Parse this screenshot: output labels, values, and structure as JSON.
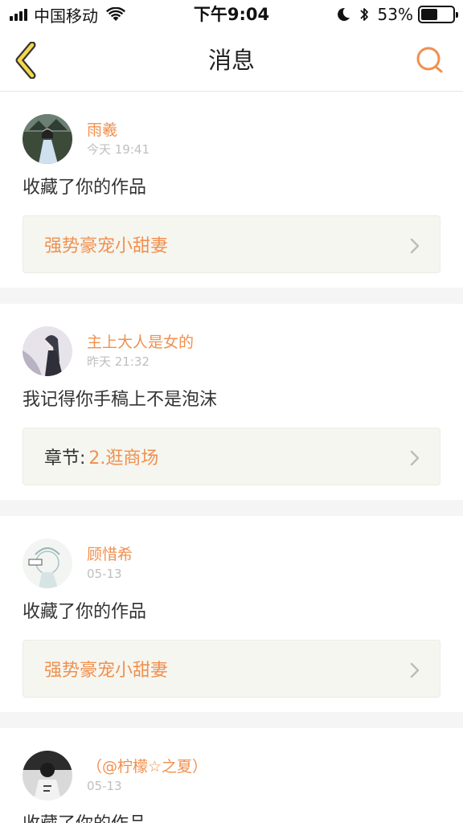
{
  "status_bar": {
    "carrier": "中国移动",
    "time": "下午9:04",
    "battery_percent": "53%",
    "battery_level": 0.53
  },
  "nav": {
    "title": "消息"
  },
  "accent_color": "#f0904f",
  "messages": [
    {
      "username": "雨羲",
      "time": "今天 19:41",
      "text": "收藏了你的作品",
      "work_title": "强势豪宠小甜妻"
    },
    {
      "username": "主上大人是女的",
      "time": "昨天 21:32",
      "text": "我记得你手稿上不是泡沫",
      "chapter_label": "章节:",
      "chapter_value": "2.逛商场"
    },
    {
      "username": "顾惜希",
      "time": "05-13",
      "text": "收藏了你的作品",
      "work_title": "强势豪宠小甜妻"
    },
    {
      "username": "（@柠檬☆之夏）",
      "time": "05-13",
      "text": "收藏了你的作品"
    }
  ]
}
